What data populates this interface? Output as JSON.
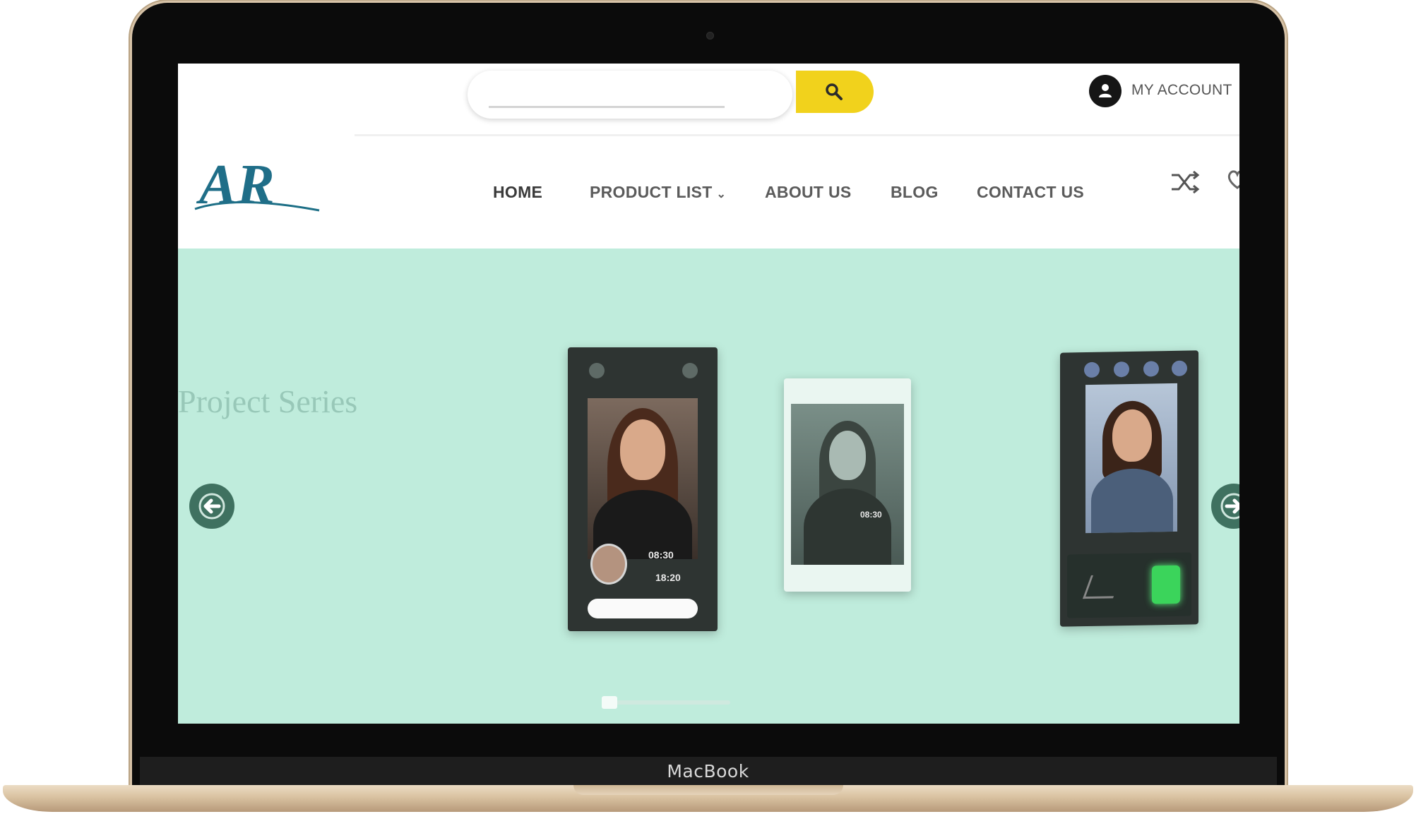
{
  "device": {
    "brand_label": "MacBook"
  },
  "header": {
    "search": {
      "placeholder": "",
      "value": ""
    },
    "account_label": "MY ACCOUNT",
    "logo_text": "AR"
  },
  "nav": {
    "items": [
      {
        "label": "HOME",
        "active": true
      },
      {
        "label": "PRODUCT LIST",
        "has_dropdown": true
      },
      {
        "label": "ABOUT US"
      },
      {
        "label": "BLOG"
      },
      {
        "label": "CONTACT US"
      }
    ]
  },
  "hero": {
    "background_color": "#bfecdc",
    "slide_title": "Project Series",
    "device1": {
      "time_top": "08:30",
      "time_bottom": "18:20"
    },
    "device2": {
      "time": "08:30"
    }
  },
  "colors": {
    "search_button": "#f1d21c",
    "arrow": "#3f7160",
    "frame_gold": "#d9c2a1"
  }
}
